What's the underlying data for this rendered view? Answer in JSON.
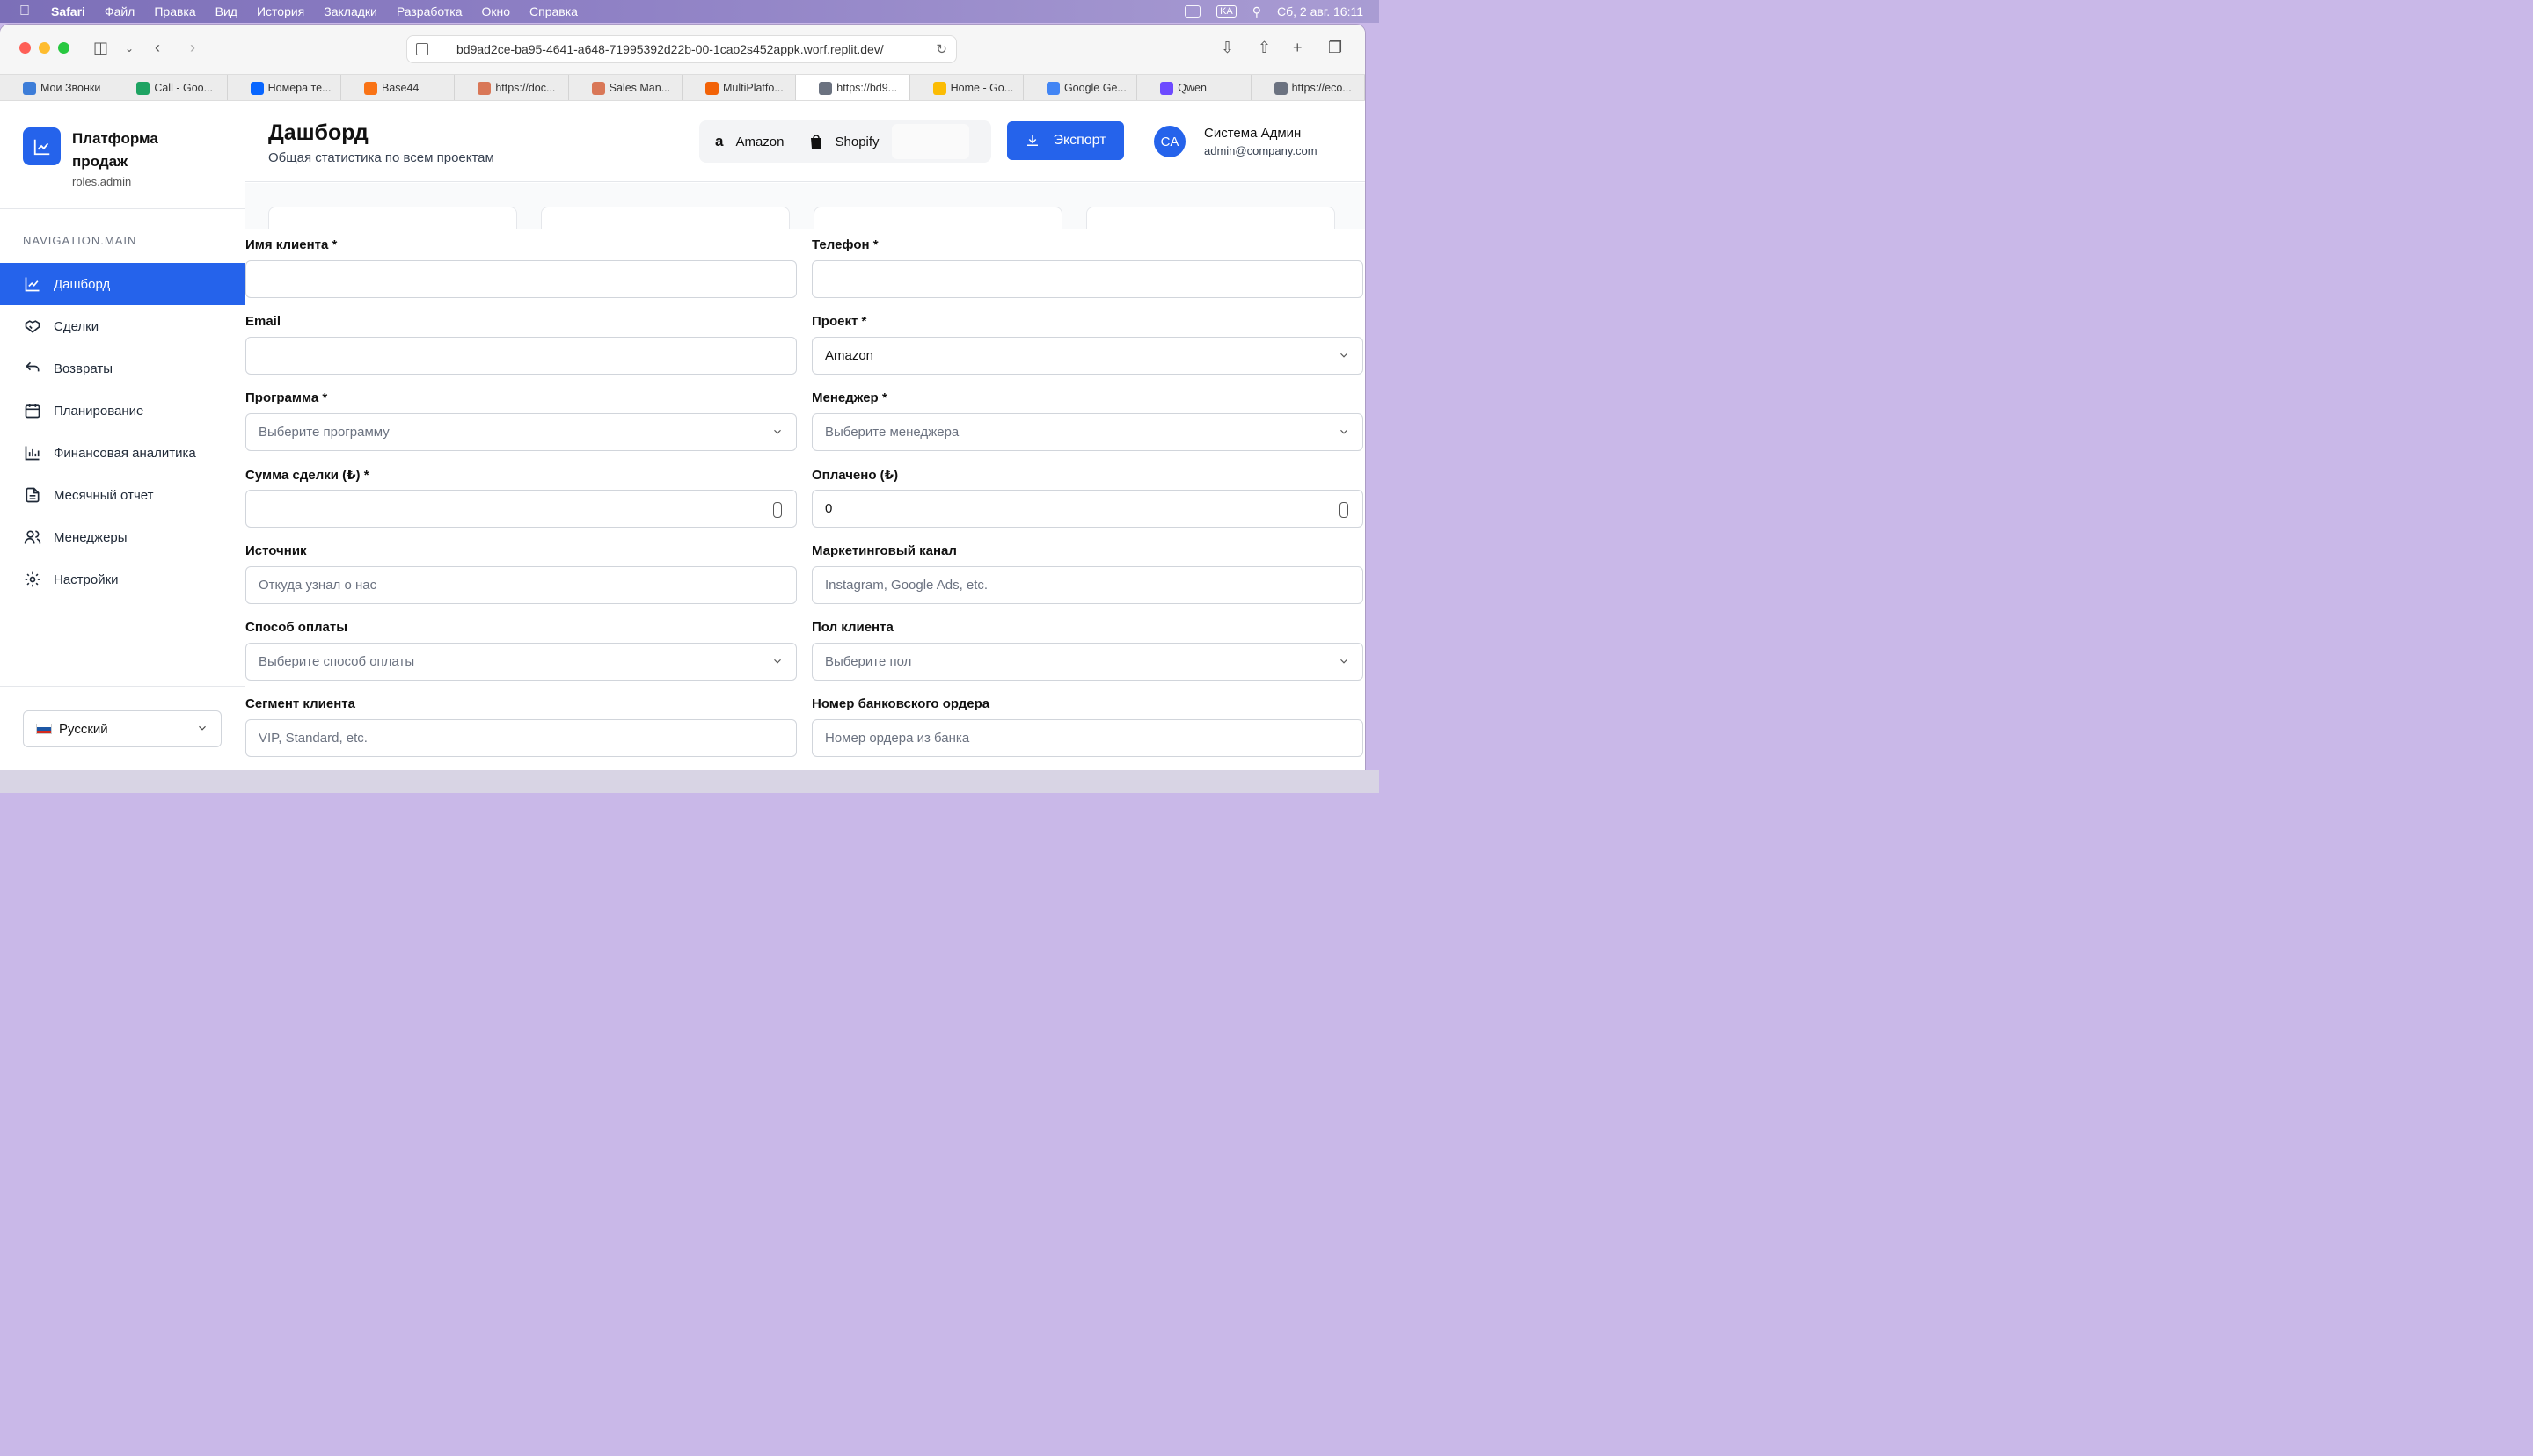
{
  "menubar": {
    "app": "Safari",
    "items": [
      "Файл",
      "Правка",
      "Вид",
      "История",
      "Закладки",
      "Разработка",
      "Окно",
      "Справка"
    ],
    "tray_badge_kb": "KA",
    "datetime": "Сб, 2 авг.  16:11"
  },
  "browser": {
    "url": "bd9ad2ce-ba95-4641-a648-71995392d22b-00-1cao2s452appk.worf.replit.dev/",
    "tabs": [
      {
        "label": "Мои Звонки",
        "color": "#3d7dd8"
      },
      {
        "label": "Call - Goo...",
        "color": "#1ea362"
      },
      {
        "label": "Номера те...",
        "color": "#0866ff"
      },
      {
        "label": "Base44",
        "color": "#f97316"
      },
      {
        "label": "https://doc...",
        "color": "#d97757"
      },
      {
        "label": "Sales Man...",
        "color": "#d97757"
      },
      {
        "label": "MultiPlatfo...",
        "color": "#f26207"
      },
      {
        "label": "https://bd9...",
        "color": "#6b7280"
      },
      {
        "label": "Home - Go...",
        "color": "#fbbc04"
      },
      {
        "label": "Google Ge...",
        "color": "#4285f4"
      },
      {
        "label": "Qwen",
        "color": "#6d4aff"
      },
      {
        "label": "https://eco...",
        "color": "#6b7280"
      }
    ],
    "active_tab_index": 7
  },
  "sidebar": {
    "brand_title": "Платформа продаж",
    "brand_role": "roles.admin",
    "nav_heading": "NAVIGATION.MAIN",
    "items": [
      {
        "label": "Дашборд",
        "icon": "chart-line-icon",
        "active": true
      },
      {
        "label": "Сделки",
        "icon": "handshake-icon"
      },
      {
        "label": "Возвраты",
        "icon": "undo-icon"
      },
      {
        "label": "Планирование",
        "icon": "calendar-icon"
      },
      {
        "label": "Финансовая аналитика",
        "icon": "bar-chart-icon"
      },
      {
        "label": "Месячный отчет",
        "icon": "document-icon"
      },
      {
        "label": "Менеджеры",
        "icon": "users-icon"
      },
      {
        "label": "Настройки",
        "icon": "gear-icon"
      }
    ],
    "language": "Русский"
  },
  "header": {
    "title": "Дашборд",
    "subtitle": "Общая статистика по всем проектам",
    "projects": [
      "Amazon",
      "Shopify"
    ],
    "export_label": "Экспорт",
    "avatar_initials": "CA",
    "user_name": "Система Админ",
    "user_email": "admin@company.com"
  },
  "form": {
    "client_name": {
      "label": "Имя клиента *",
      "value": ""
    },
    "phone": {
      "label": "Телефон *",
      "value": ""
    },
    "email": {
      "label": "Email",
      "value": ""
    },
    "project": {
      "label": "Проект *",
      "value": "Amazon"
    },
    "program": {
      "label": "Программа *",
      "placeholder": "Выберите программу"
    },
    "manager": {
      "label": "Менеджер *",
      "placeholder": "Выберите менеджера"
    },
    "deal_amount": {
      "label": "Сумма сделки (₺) *",
      "value": ""
    },
    "paid": {
      "label": "Оплачено (₺)",
      "value": "0"
    },
    "source": {
      "label": "Источник",
      "placeholder": "Откуда узнал о нас"
    },
    "marketing_channel": {
      "label": "Маркетинговый канал",
      "placeholder": "Instagram, Google Ads, etc."
    },
    "payment_method": {
      "label": "Способ оплаты",
      "placeholder": "Выберите способ оплаты"
    },
    "client_gender": {
      "label": "Пол клиента",
      "placeholder": "Выберите пол"
    },
    "client_segment": {
      "label": "Сегмент клиента",
      "placeholder": "VIP, Standard, etc."
    },
    "bank_order": {
      "label": "Номер банковского ордера",
      "placeholder": "Номер ордера из банка"
    }
  },
  "colors": {
    "accent": "#2563eb"
  }
}
